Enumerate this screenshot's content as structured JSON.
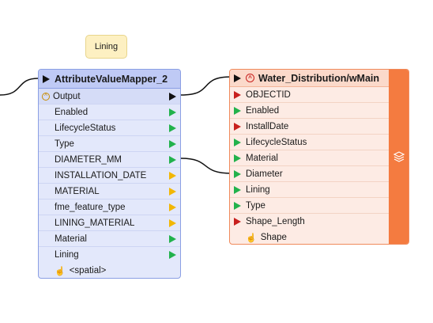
{
  "annotation": {
    "text": "Lining"
  },
  "transformer": {
    "name": "AttributeValueMapper_2",
    "output_port": "Output",
    "ports": [
      {
        "label": "Enabled",
        "color": "green"
      },
      {
        "label": "LifecycleStatus",
        "color": "green"
      },
      {
        "label": "Type",
        "color": "green"
      },
      {
        "label": "DIAMETER_MM",
        "color": "green"
      },
      {
        "label": "INSTALLATION_DATE",
        "color": "yellow"
      },
      {
        "label": "MATERIAL",
        "color": "yellow"
      },
      {
        "label": "fme_feature_type",
        "color": "yellow"
      },
      {
        "label": "LINING_MATERIAL",
        "color": "yellow"
      },
      {
        "label": "Material",
        "color": "green"
      },
      {
        "label": "Lining",
        "color": "green"
      }
    ],
    "spatial_label": "<spatial>",
    "colors": {
      "green": "#22b24c",
      "yellow": "#f2b705",
      "header": "#bfcaf5"
    }
  },
  "writer": {
    "name": "Water_Distribution/wMain",
    "ports": [
      {
        "label": "OBJECTID",
        "color": "red"
      },
      {
        "label": "Enabled",
        "color": "green"
      },
      {
        "label": "InstallDate",
        "color": "red"
      },
      {
        "label": "LifecycleStatus",
        "color": "green"
      },
      {
        "label": "Material",
        "color": "green"
      },
      {
        "label": "Diameter",
        "color": "green"
      },
      {
        "label": "Lining",
        "color": "green"
      },
      {
        "label": "Type",
        "color": "green"
      },
      {
        "label": "Shape_Length",
        "color": "red"
      }
    ],
    "geometry_label": "Shape",
    "colors": {
      "red": "#c8201e",
      "side": "#f47b40"
    }
  },
  "icons": {
    "input_arrow": "triangle-right",
    "conditional": "circle-caret",
    "geometry": "hand-pointer",
    "stack": "layers"
  }
}
